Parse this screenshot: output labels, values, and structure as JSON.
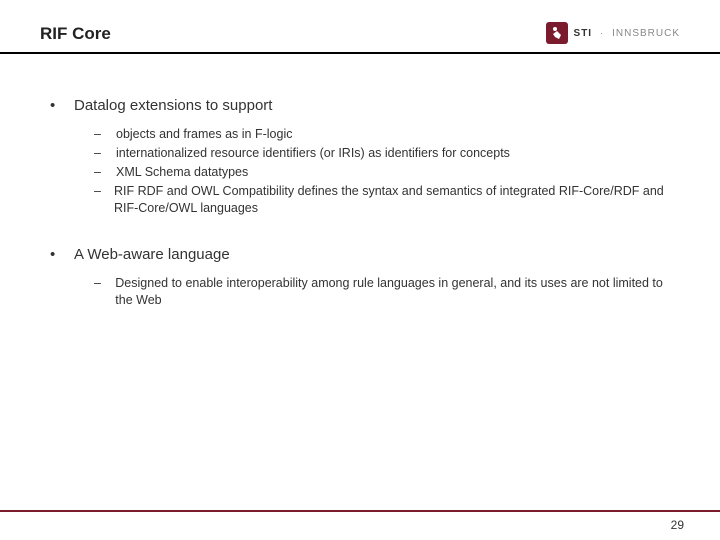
{
  "header": {
    "title": "RIF Core",
    "logo": {
      "brand": "STI",
      "separator": "·",
      "location": "INNSBRUCK"
    }
  },
  "content": {
    "sections": [
      {
        "heading": "Datalog extensions to support",
        "items": [
          "objects and frames as in F-logic",
          "internationalized resource identifiers (or IRIs) as identifiers for concepts",
          "XML Schema datatypes",
          "RIF RDF and OWL Compatibility defines the syntax and semantics of integrated RIF-Core/RDF and RIF-Core/OWL languages"
        ]
      },
      {
        "heading": "A Web-aware language",
        "items": [
          "Designed to enable interoperability among rule languages in general, and its uses are not limited to the Web"
        ]
      }
    ]
  },
  "footer": {
    "page_number": "29"
  }
}
